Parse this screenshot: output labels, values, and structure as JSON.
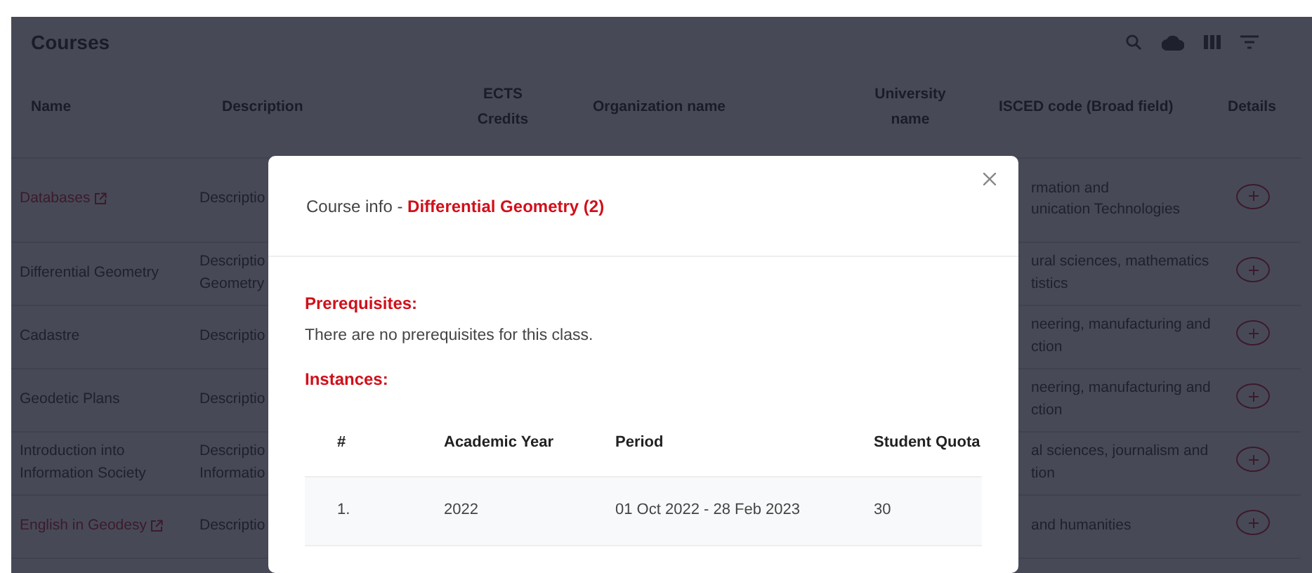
{
  "card": {
    "title": "Courses"
  },
  "table": {
    "columns": [
      {
        "label": "Name"
      },
      {
        "label": "Description"
      },
      {
        "label": "ECTS Credits"
      },
      {
        "label": "Organization name"
      },
      {
        "label": "University name"
      },
      {
        "label": "ISCED code (Broad field)"
      },
      {
        "label": "Details"
      }
    ],
    "rows": [
      {
        "kind": "link",
        "name": "Databases",
        "description": [
          "Descriptio"
        ],
        "isced": [
          "rmation and",
          "unication Technologies"
        ]
      },
      {
        "kind": "text",
        "name": "Differential Geometry",
        "description": [
          "Descriptio",
          "Geometry"
        ],
        "isced": [
          "ural sciences, mathematics",
          "tistics"
        ]
      },
      {
        "kind": "text",
        "name": "Cadastre",
        "description": [
          "Descriptio"
        ],
        "isced": [
          "neering, manufacturing and",
          "ction"
        ]
      },
      {
        "kind": "text",
        "name": "Geodetic Plans",
        "description": [
          "Descriptio"
        ],
        "isced": [
          "neering, manufacturing and",
          "ction"
        ]
      },
      {
        "kind": "text",
        "name": "Introduction into Information Society",
        "description": [
          "Descriptio",
          "Informatio"
        ],
        "isced": [
          "al sciences, journalism and",
          "tion"
        ]
      },
      {
        "kind": "link",
        "name": "English in Geodesy",
        "description": [
          "Descriptio"
        ],
        "isced": [
          "and humanities"
        ]
      }
    ]
  },
  "modal": {
    "title": "Course info -",
    "course": "Differential Geometry (2)",
    "sections": [
      {
        "heading": "Prerequisites:",
        "text": "There are no prerequisites for this class."
      },
      {
        "heading": "Instances:"
      }
    ],
    "instances": {
      "columns": [
        "#",
        "Academic Year",
        "Period",
        "Student Quota"
      ],
      "rows": [
        [
          "1.",
          "2022",
          "01 Oct 2022 - 28 Feb 2023",
          "30"
        ]
      ]
    }
  }
}
